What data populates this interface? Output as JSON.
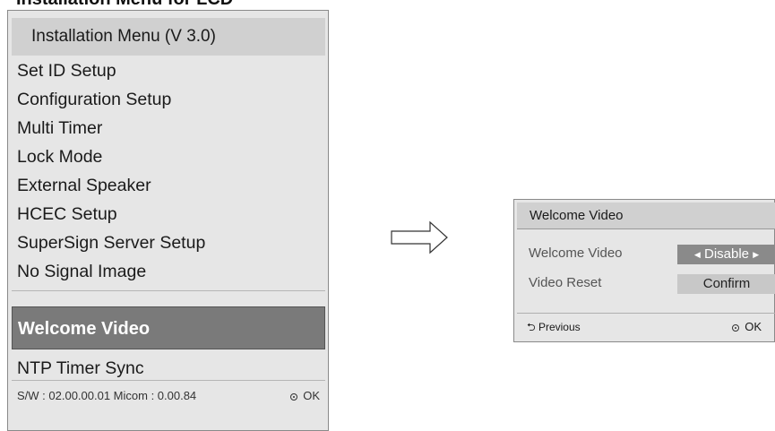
{
  "top_heading": "Installation Menu for LCD",
  "menu": {
    "title": "Installation Menu (V 3.0)",
    "items": [
      "Set ID Setup",
      "Configuration Setup",
      "Multi Timer",
      "Lock Mode",
      "External Speaker",
      "HCEC Setup",
      "SuperSign Server Setup",
      "No Signal Image",
      "Welcome Video",
      "NTP Timer Sync"
    ],
    "selected_index": 8,
    "footer_version": "S/W : 02.00.00.01 Micom : 0.00.84",
    "footer_ok": "OK"
  },
  "dialog": {
    "title": "Welcome Video",
    "rows": [
      {
        "label": "Welcome Video",
        "value": "Disable"
      },
      {
        "label": "Video Reset",
        "value": "Confirm"
      }
    ],
    "previous_label": "Previous",
    "ok_label": "OK"
  }
}
